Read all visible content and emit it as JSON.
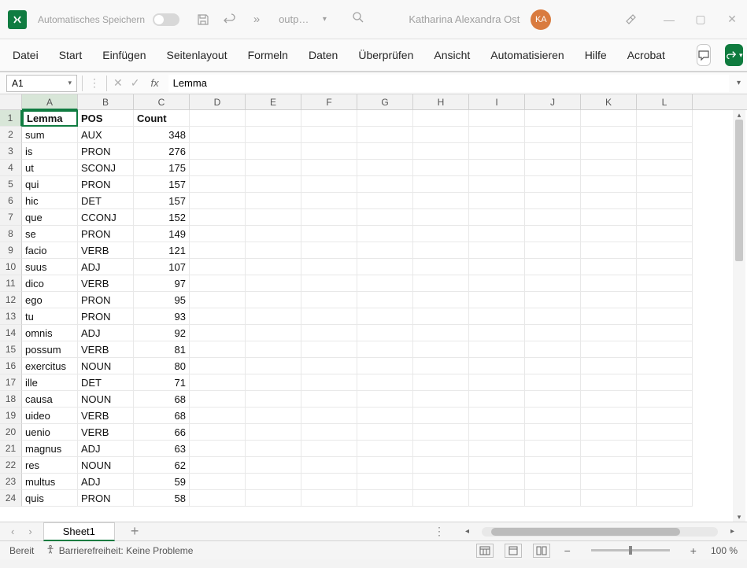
{
  "titlebar": {
    "autosave_label": "Automatisches Speichern",
    "filename": "outp…",
    "username": "Katharina Alexandra Ost",
    "avatar_initials": "KA"
  },
  "ribbon": {
    "tabs": [
      "Datei",
      "Start",
      "Einfügen",
      "Seitenlayout",
      "Formeln",
      "Daten",
      "Überprüfen",
      "Ansicht",
      "Automatisieren",
      "Hilfe",
      "Acrobat"
    ]
  },
  "formula_bar": {
    "cell_ref": "A1",
    "formula": "Lemma"
  },
  "grid": {
    "columns": [
      "A",
      "B",
      "C",
      "D",
      "E",
      "F",
      "G",
      "H",
      "I",
      "J",
      "K",
      "L"
    ],
    "headers": [
      "Lemma",
      "POS",
      "Count"
    ],
    "rows": [
      {
        "lemma": "sum",
        "pos": "AUX",
        "count": 348
      },
      {
        "lemma": "is",
        "pos": "PRON",
        "count": 276
      },
      {
        "lemma": "ut",
        "pos": "SCONJ",
        "count": 175
      },
      {
        "lemma": "qui",
        "pos": "PRON",
        "count": 157
      },
      {
        "lemma": "hic",
        "pos": "DET",
        "count": 157
      },
      {
        "lemma": "que",
        "pos": "CCONJ",
        "count": 152
      },
      {
        "lemma": "se",
        "pos": "PRON",
        "count": 149
      },
      {
        "lemma": "facio",
        "pos": "VERB",
        "count": 121
      },
      {
        "lemma": "suus",
        "pos": "ADJ",
        "count": 107
      },
      {
        "lemma": "dico",
        "pos": "VERB",
        "count": 97
      },
      {
        "lemma": "ego",
        "pos": "PRON",
        "count": 95
      },
      {
        "lemma": "tu",
        "pos": "PRON",
        "count": 93
      },
      {
        "lemma": "omnis",
        "pos": "ADJ",
        "count": 92
      },
      {
        "lemma": "possum",
        "pos": "VERB",
        "count": 81
      },
      {
        "lemma": "exercitus",
        "pos": "NOUN",
        "count": 80
      },
      {
        "lemma": "ille",
        "pos": "DET",
        "count": 71
      },
      {
        "lemma": "causa",
        "pos": "NOUN",
        "count": 68
      },
      {
        "lemma": "uideo",
        "pos": "VERB",
        "count": 68
      },
      {
        "lemma": "uenio",
        "pos": "VERB",
        "count": 66
      },
      {
        "lemma": "magnus",
        "pos": "ADJ",
        "count": 63
      },
      {
        "lemma": "res",
        "pos": "NOUN",
        "count": 62
      },
      {
        "lemma": "multus",
        "pos": "ADJ",
        "count": 59
      },
      {
        "lemma": "quis",
        "pos": "PRON",
        "count": 58
      }
    ]
  },
  "sheet_tabs": {
    "active": "Sheet1"
  },
  "statusbar": {
    "ready": "Bereit",
    "accessibility": "Barrierefreiheit: Keine Probleme",
    "zoom": "100 %"
  }
}
